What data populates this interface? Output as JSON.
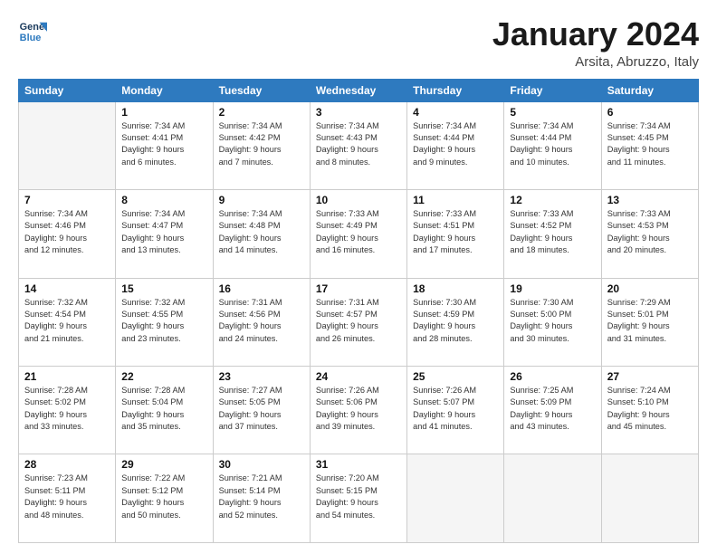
{
  "logo": {
    "line1": "General",
    "line2": "Blue"
  },
  "title": "January 2024",
  "subtitle": "Arsita, Abruzzo, Italy",
  "weekdays": [
    "Sunday",
    "Monday",
    "Tuesday",
    "Wednesday",
    "Thursday",
    "Friday",
    "Saturday"
  ],
  "weeks": [
    [
      {
        "day": "",
        "info": ""
      },
      {
        "day": "1",
        "info": "Sunrise: 7:34 AM\nSunset: 4:41 PM\nDaylight: 9 hours\nand 6 minutes."
      },
      {
        "day": "2",
        "info": "Sunrise: 7:34 AM\nSunset: 4:42 PM\nDaylight: 9 hours\nand 7 minutes."
      },
      {
        "day": "3",
        "info": "Sunrise: 7:34 AM\nSunset: 4:43 PM\nDaylight: 9 hours\nand 8 minutes."
      },
      {
        "day": "4",
        "info": "Sunrise: 7:34 AM\nSunset: 4:44 PM\nDaylight: 9 hours\nand 9 minutes."
      },
      {
        "day": "5",
        "info": "Sunrise: 7:34 AM\nSunset: 4:44 PM\nDaylight: 9 hours\nand 10 minutes."
      },
      {
        "day": "6",
        "info": "Sunrise: 7:34 AM\nSunset: 4:45 PM\nDaylight: 9 hours\nand 11 minutes."
      }
    ],
    [
      {
        "day": "7",
        "info": "Sunrise: 7:34 AM\nSunset: 4:46 PM\nDaylight: 9 hours\nand 12 minutes."
      },
      {
        "day": "8",
        "info": "Sunrise: 7:34 AM\nSunset: 4:47 PM\nDaylight: 9 hours\nand 13 minutes."
      },
      {
        "day": "9",
        "info": "Sunrise: 7:34 AM\nSunset: 4:48 PM\nDaylight: 9 hours\nand 14 minutes."
      },
      {
        "day": "10",
        "info": "Sunrise: 7:33 AM\nSunset: 4:49 PM\nDaylight: 9 hours\nand 16 minutes."
      },
      {
        "day": "11",
        "info": "Sunrise: 7:33 AM\nSunset: 4:51 PM\nDaylight: 9 hours\nand 17 minutes."
      },
      {
        "day": "12",
        "info": "Sunrise: 7:33 AM\nSunset: 4:52 PM\nDaylight: 9 hours\nand 18 minutes."
      },
      {
        "day": "13",
        "info": "Sunrise: 7:33 AM\nSunset: 4:53 PM\nDaylight: 9 hours\nand 20 minutes."
      }
    ],
    [
      {
        "day": "14",
        "info": "Sunrise: 7:32 AM\nSunset: 4:54 PM\nDaylight: 9 hours\nand 21 minutes."
      },
      {
        "day": "15",
        "info": "Sunrise: 7:32 AM\nSunset: 4:55 PM\nDaylight: 9 hours\nand 23 minutes."
      },
      {
        "day": "16",
        "info": "Sunrise: 7:31 AM\nSunset: 4:56 PM\nDaylight: 9 hours\nand 24 minutes."
      },
      {
        "day": "17",
        "info": "Sunrise: 7:31 AM\nSunset: 4:57 PM\nDaylight: 9 hours\nand 26 minutes."
      },
      {
        "day": "18",
        "info": "Sunrise: 7:30 AM\nSunset: 4:59 PM\nDaylight: 9 hours\nand 28 minutes."
      },
      {
        "day": "19",
        "info": "Sunrise: 7:30 AM\nSunset: 5:00 PM\nDaylight: 9 hours\nand 30 minutes."
      },
      {
        "day": "20",
        "info": "Sunrise: 7:29 AM\nSunset: 5:01 PM\nDaylight: 9 hours\nand 31 minutes."
      }
    ],
    [
      {
        "day": "21",
        "info": "Sunrise: 7:28 AM\nSunset: 5:02 PM\nDaylight: 9 hours\nand 33 minutes."
      },
      {
        "day": "22",
        "info": "Sunrise: 7:28 AM\nSunset: 5:04 PM\nDaylight: 9 hours\nand 35 minutes."
      },
      {
        "day": "23",
        "info": "Sunrise: 7:27 AM\nSunset: 5:05 PM\nDaylight: 9 hours\nand 37 minutes."
      },
      {
        "day": "24",
        "info": "Sunrise: 7:26 AM\nSunset: 5:06 PM\nDaylight: 9 hours\nand 39 minutes."
      },
      {
        "day": "25",
        "info": "Sunrise: 7:26 AM\nSunset: 5:07 PM\nDaylight: 9 hours\nand 41 minutes."
      },
      {
        "day": "26",
        "info": "Sunrise: 7:25 AM\nSunset: 5:09 PM\nDaylight: 9 hours\nand 43 minutes."
      },
      {
        "day": "27",
        "info": "Sunrise: 7:24 AM\nSunset: 5:10 PM\nDaylight: 9 hours\nand 45 minutes."
      }
    ],
    [
      {
        "day": "28",
        "info": "Sunrise: 7:23 AM\nSunset: 5:11 PM\nDaylight: 9 hours\nand 48 minutes."
      },
      {
        "day": "29",
        "info": "Sunrise: 7:22 AM\nSunset: 5:12 PM\nDaylight: 9 hours\nand 50 minutes."
      },
      {
        "day": "30",
        "info": "Sunrise: 7:21 AM\nSunset: 5:14 PM\nDaylight: 9 hours\nand 52 minutes."
      },
      {
        "day": "31",
        "info": "Sunrise: 7:20 AM\nSunset: 5:15 PM\nDaylight: 9 hours\nand 54 minutes."
      },
      {
        "day": "",
        "info": ""
      },
      {
        "day": "",
        "info": ""
      },
      {
        "day": "",
        "info": ""
      }
    ]
  ]
}
